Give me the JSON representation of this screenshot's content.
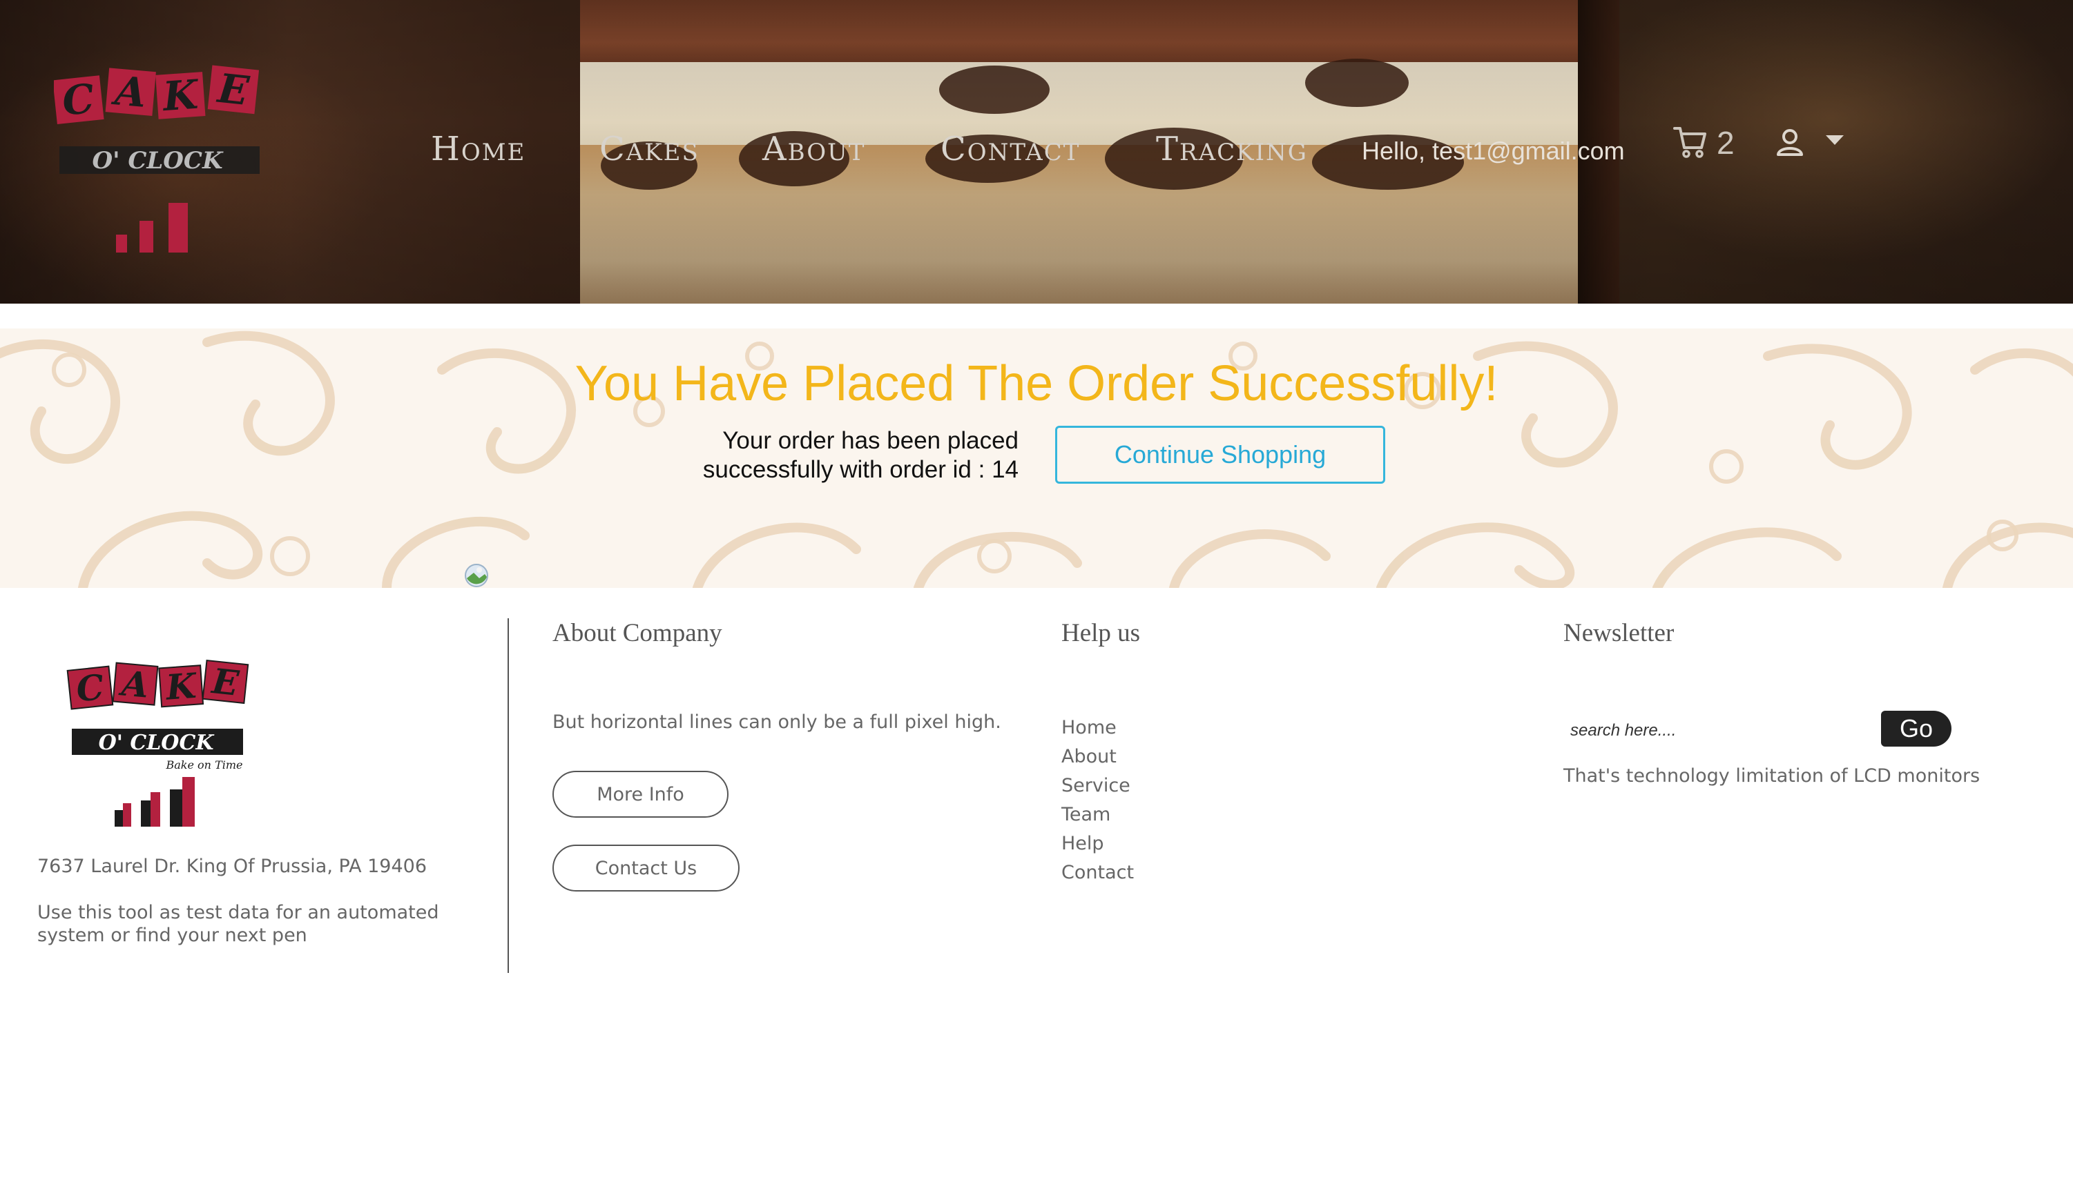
{
  "nav": {
    "items": [
      {
        "label": "Home"
      },
      {
        "label": "Cakes"
      },
      {
        "label": "About"
      },
      {
        "label": "Contact"
      },
      {
        "label": "Tracking"
      }
    ],
    "greeting": "Hello, test1@gmail.com",
    "cart_count": "2",
    "icons": {
      "cart": "shopping-cart-icon",
      "user": "user-icon",
      "dropdown": "caret-down-icon"
    }
  },
  "brand": {
    "logo_letters": [
      "C",
      "A",
      "K",
      "E"
    ],
    "logo_subtitle": "O' CLOCK",
    "logo_tagline": "Bake on Time",
    "colors": {
      "logo_red": "#b3213f",
      "logo_black": "#1c1c1c"
    }
  },
  "success": {
    "title": "You Have Placed The Order Successfully!",
    "message": "Your order has been placed successfully with order id : 14",
    "continue_label": "Continue Shopping",
    "colors": {
      "title": "#f3b61a",
      "button": "#35b6dc"
    }
  },
  "footer": {
    "address": "7637 Laurel Dr. King Of Prussia, PA 19406",
    "tool_text": "Use this tool as test data for an automated system or find your next pen",
    "about": {
      "heading": "About Company",
      "text": "But horizontal lines can only be a full pixel high.",
      "more_info_label": "More Info",
      "contact_label": "Contact Us"
    },
    "help": {
      "heading": "Help us",
      "links": [
        "Home",
        "About",
        "Service",
        "Team",
        "Help",
        "Contact"
      ]
    },
    "newsletter": {
      "heading": "Newsletter",
      "placeholder": "search here....",
      "go_label": "Go",
      "text": "That's technology limitation of LCD monitors"
    }
  }
}
